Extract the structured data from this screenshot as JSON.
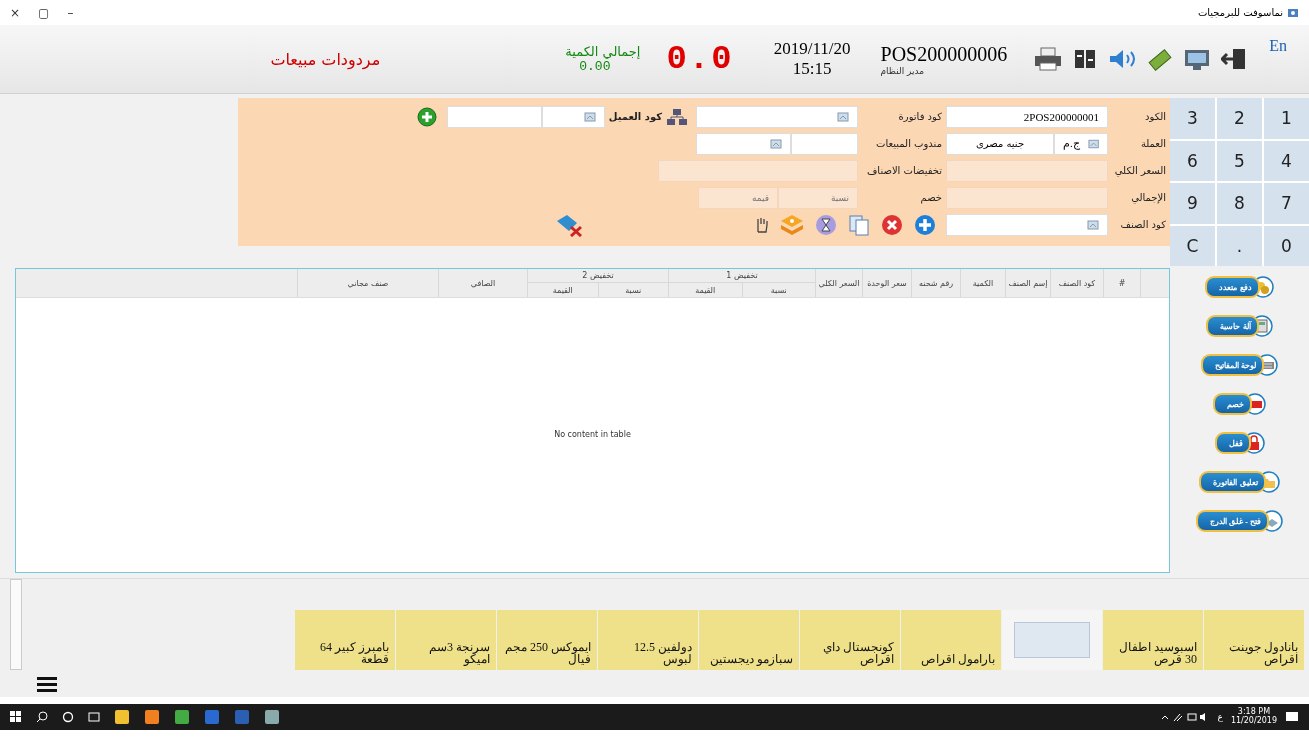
{
  "window": {
    "title": "نماسوفت للبرمجيات",
    "controls": [
      "–",
      "▢",
      "×"
    ]
  },
  "header": {
    "language": "En",
    "pos_number": "POS200000006",
    "user": "مدير النظام",
    "date": "2019/11/20",
    "time": "15:15",
    "total_display": "0.0",
    "total_qty_label": "إجمالي الكمية",
    "total_qty": "0.00",
    "screen_title": "مردودات مبيعات"
  },
  "keypad": [
    "1",
    "2",
    "3",
    "4",
    "5",
    "6",
    "7",
    "8",
    "9",
    "0",
    ".",
    "C"
  ],
  "form": {
    "code": {
      "label": "الكود",
      "value": "2POS200000001"
    },
    "currency": {
      "label": "العملة",
      "symbol": "ج.م",
      "name": "جنيه مصرى"
    },
    "total_price": {
      "label": "السعر الكلي"
    },
    "grand_total": {
      "label": "الإجمالي"
    },
    "item_code": {
      "label": "كود الصنف"
    },
    "invoice_code": {
      "label": "كود فاتورة"
    },
    "sales_rep": {
      "label": "مندوب المبيعات"
    },
    "item_discounts": {
      "label": "تخفيضات الاصناف"
    },
    "discount": {
      "label": "خصم",
      "percent_placeholder": "نسبة",
      "value_placeholder": "قيمه"
    },
    "customer_code": {
      "label": "كود العميل"
    }
  },
  "table": {
    "columns": [
      {
        "label": "#"
      },
      {
        "label": "كود الصنف"
      },
      {
        "label": "إسم الصنف"
      },
      {
        "label": "الكمية"
      },
      {
        "label": "رقم شحنه"
      },
      {
        "label": "سعر الوحدة"
      },
      {
        "label": "السعر الكلي"
      },
      {
        "label": "تخفيض 1",
        "sub": [
          "نسبة",
          "القيمة"
        ]
      },
      {
        "label": "تخفيض 2",
        "sub": [
          "نسبة",
          "القيمة"
        ]
      },
      {
        "label": "الصافي"
      },
      {
        "label": "صنف مجاني"
      }
    ],
    "empty_text": "No content in table"
  },
  "side_buttons": [
    {
      "label": "دفع متعدد",
      "kind": "coins"
    },
    {
      "label": "آلة حاسبة",
      "kind": "calculator"
    },
    {
      "label": "لوحة المفاتيح",
      "kind": "keyboard"
    },
    {
      "label": "خصم",
      "kind": "discount"
    },
    {
      "label": "قفل",
      "kind": "lock"
    },
    {
      "label": "تعليق الفاتورة",
      "kind": "folder"
    },
    {
      "label": "فتح - غلق الدرج",
      "kind": "drawer"
    }
  ],
  "products": [
    {
      "kind": "text",
      "name": "بانادول جوينت اقراص"
    },
    {
      "kind": "text",
      "name": "اسبوسيد اطفال 30 قرص"
    },
    {
      "kind": "image"
    },
    {
      "kind": "text",
      "name": "بارامول اقراص"
    },
    {
      "kind": "text",
      "name": "كونجستال داي اقراص"
    },
    {
      "kind": "text",
      "name": "سبازمو ديجستين"
    },
    {
      "kind": "text",
      "name": "دولفين 12.5 لبوس"
    },
    {
      "kind": "text",
      "name": "ايموكس 250 مجم فيال"
    },
    {
      "kind": "text",
      "name": "سرنجة 3سم اميكو"
    },
    {
      "kind": "text",
      "name": "بامبرز كبير 64 قطعة"
    }
  ],
  "taskbar": {
    "language": "ع",
    "time": "3:18 PM",
    "date": "11/20/2019"
  }
}
